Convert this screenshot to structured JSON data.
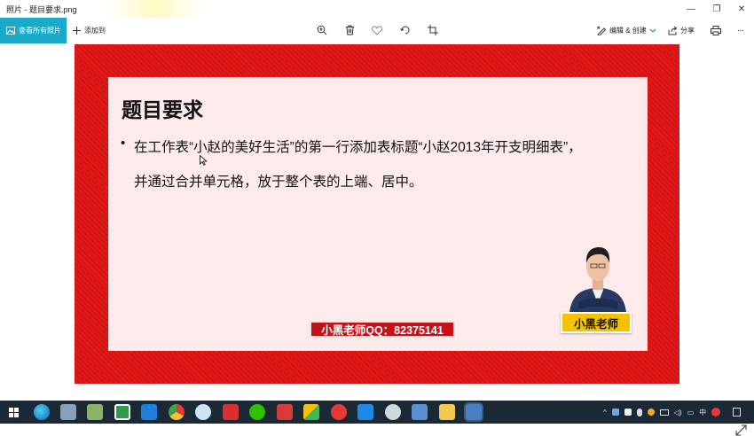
{
  "window": {
    "title": "照片 - 题目要求.png",
    "minimize": "—",
    "restore": "❐",
    "close": "✕"
  },
  "toolbar": {
    "view_all_label": "查看所有照片",
    "add_to_label": "添加到",
    "zoom_icon": "zoom-in-icon",
    "edit_create_label": "编辑 & 创建",
    "share_label": "分享",
    "more_label": "···"
  },
  "slide": {
    "title": "题目要求",
    "bullet": "•",
    "line1": "在工作表“小赵的美好生活”的第一行添加表标题“小赵2013年开支明细表”，",
    "line2": "并通过合并单元格，放于整个表的上端、居中。",
    "qq_badge": "小黑老师QQ：82375141",
    "teacher_name": "小黑老师"
  },
  "colors": {
    "accent": "#19a9c9",
    "slide_border": "#e01818",
    "slide_bg": "#fdeaea",
    "qq_badge_bg": "#c4121b",
    "name_badge_bg": "#f5c200",
    "taskbar_bg": "#1b2836"
  },
  "taskbar": {
    "apps": [
      "start-icon",
      "search-icon",
      "edge-icon",
      "explorer-icon",
      "app-green-icon",
      "app-green2-icon",
      "app-blue-icon",
      "chrome-icon",
      "app-cloud-icon",
      "xmind-icon",
      "wechat-icon",
      "app-red-icon",
      "app-multicolor-icon",
      "netease-icon",
      "wps-icon",
      "app-cloud2-icon",
      "app-screenshot-icon",
      "folder-icon",
      "photos-icon"
    ],
    "ime": "中",
    "notification_icon": "notification-icon"
  }
}
